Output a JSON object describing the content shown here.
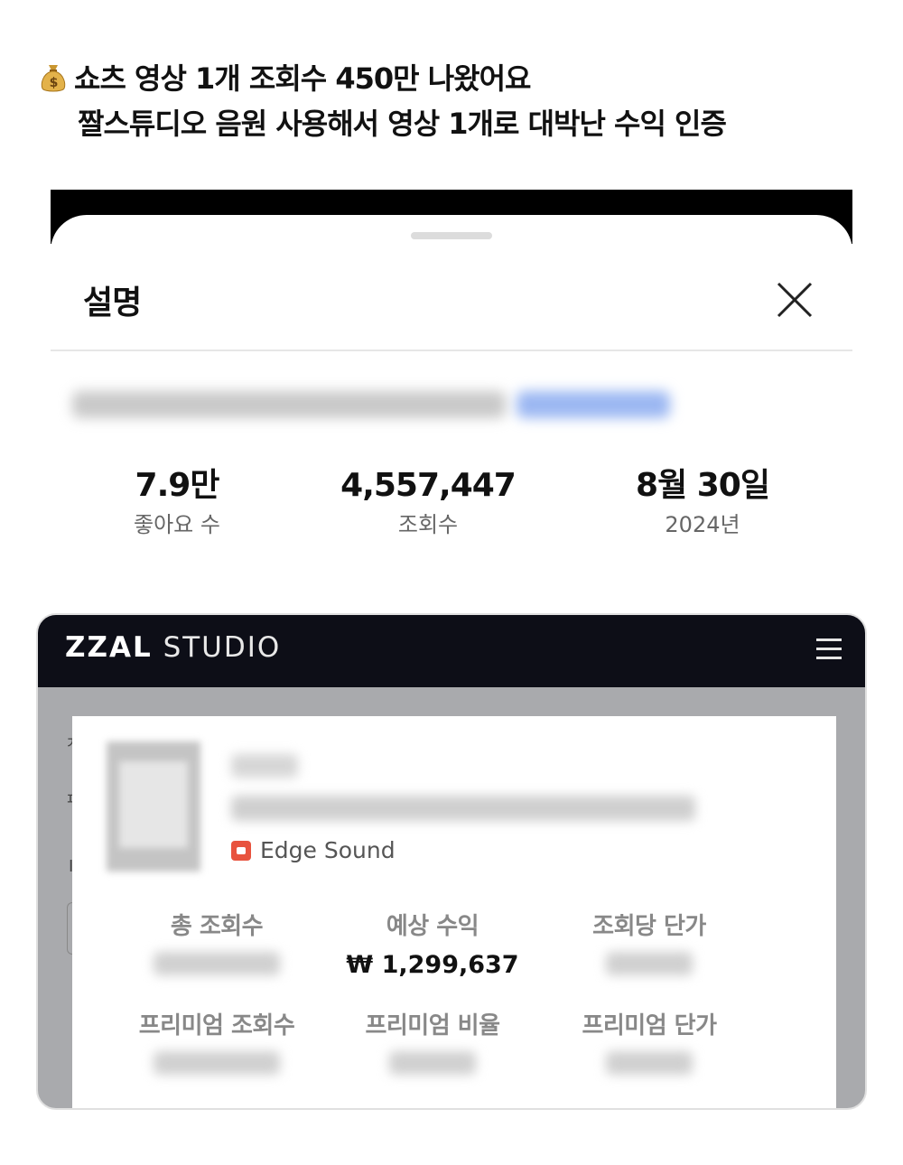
{
  "headline": {
    "line1": "쇼츠 영상 1개 조회수 450만 나왔어요",
    "line2": "짤스튜디오 음원 사용해서 영상 1개로 대박난 수익 인증",
    "icon": "money-bag-icon"
  },
  "sheet": {
    "title": "설명",
    "close_icon": "close-icon",
    "stats": [
      {
        "value": "7.9만",
        "label": "좋아요 수"
      },
      {
        "value": "4,557,447",
        "label": "조회수"
      },
      {
        "value": "8월 30일",
        "label": "2024년"
      }
    ]
  },
  "app": {
    "logo_strong": "ZZAL",
    "logo_light": "STUDIO",
    "menu_icon": "hamburger-menu-icon",
    "sound_name": "Edge Sound",
    "metrics": [
      {
        "label": "총 조회수",
        "value": null
      },
      {
        "label": "예상 수익",
        "value": "₩ 1,299,637"
      },
      {
        "label": "조회당 단가",
        "value": null
      },
      {
        "label": "프리미엄 조회수",
        "value": null
      },
      {
        "label": "프리미엄 비율",
        "value": null
      },
      {
        "label": "프리미엄 단가",
        "value": null
      }
    ]
  },
  "colors": {
    "header_bg": "#0d0e17",
    "sound_icon": "#e8533e",
    "app_bg": "#a9aaad"
  }
}
